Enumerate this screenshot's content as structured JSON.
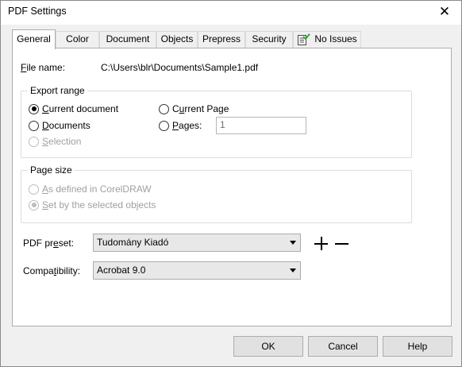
{
  "window": {
    "title": "PDF Settings",
    "close_icon": "close-icon"
  },
  "tabs": [
    {
      "label": "General",
      "active": true
    },
    {
      "label": "Color"
    },
    {
      "label": "Document"
    },
    {
      "label": "Objects"
    },
    {
      "label": "Prepress"
    },
    {
      "label": "Security"
    },
    {
      "label": "No Issues",
      "icon": "checklist-icon"
    }
  ],
  "general": {
    "file_name_label": "File name:",
    "file_name_value": "C:\\Users\\blr\\Documents\\Sample1.pdf",
    "export_range": {
      "title": "Export range",
      "options": {
        "current_document": "Current document",
        "documents": "Documents",
        "selection": "Selection",
        "current_page": "Current Page",
        "pages": "Pages:"
      },
      "selected": "current_document",
      "pages_value": "1"
    },
    "page_size": {
      "title": "Page size",
      "options": {
        "as_defined": "As defined in CorelDRAW",
        "set_by_objects": "Set by the selected objects"
      },
      "selected": "set_by_objects"
    },
    "pdf_preset_label": "PDF preset:",
    "pdf_preset_value": "Tudomány Kiadó",
    "compatibility_label": "Compatibility:",
    "compatibility_value": "Acrobat 9.0"
  },
  "buttons": {
    "ok": "OK",
    "cancel": "Cancel",
    "help": "Help"
  },
  "colors": {
    "accent_check": "#3aa63a",
    "window_bg": "#f0f0f0",
    "panel_bg": "#ffffff"
  }
}
